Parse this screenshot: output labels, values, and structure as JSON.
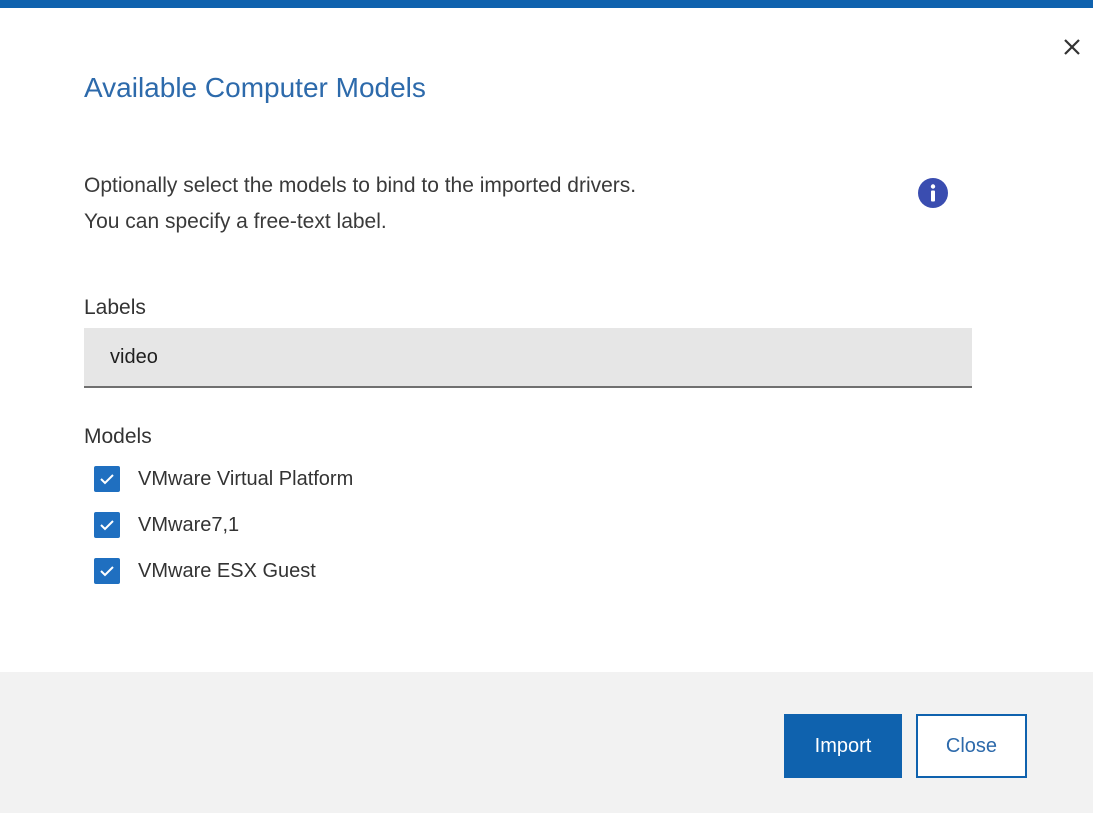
{
  "dialog": {
    "title": "Available Computer Models",
    "description_line1": "Optionally select the models to bind to the imported drivers.",
    "description_line2": "You can specify a free-text label.",
    "close_icon": "close-icon",
    "info_icon": "info-icon"
  },
  "labels_field": {
    "label": "Labels",
    "value": "video"
  },
  "models": {
    "label": "Models",
    "items": [
      {
        "label": "VMware Virtual Platform",
        "checked": true
      },
      {
        "label": "VMware7,1",
        "checked": true
      },
      {
        "label": "VMware ESX Guest",
        "checked": true
      }
    ]
  },
  "footer": {
    "import_label": "Import",
    "close_label": "Close"
  },
  "colors": {
    "accent": "#0f62ae",
    "title": "#2d6aab",
    "checkbox": "#1f6fc0",
    "input_bg": "#e6e6e6",
    "footer_bg": "#f2f2f2",
    "info_icon": "#3a4db0"
  }
}
